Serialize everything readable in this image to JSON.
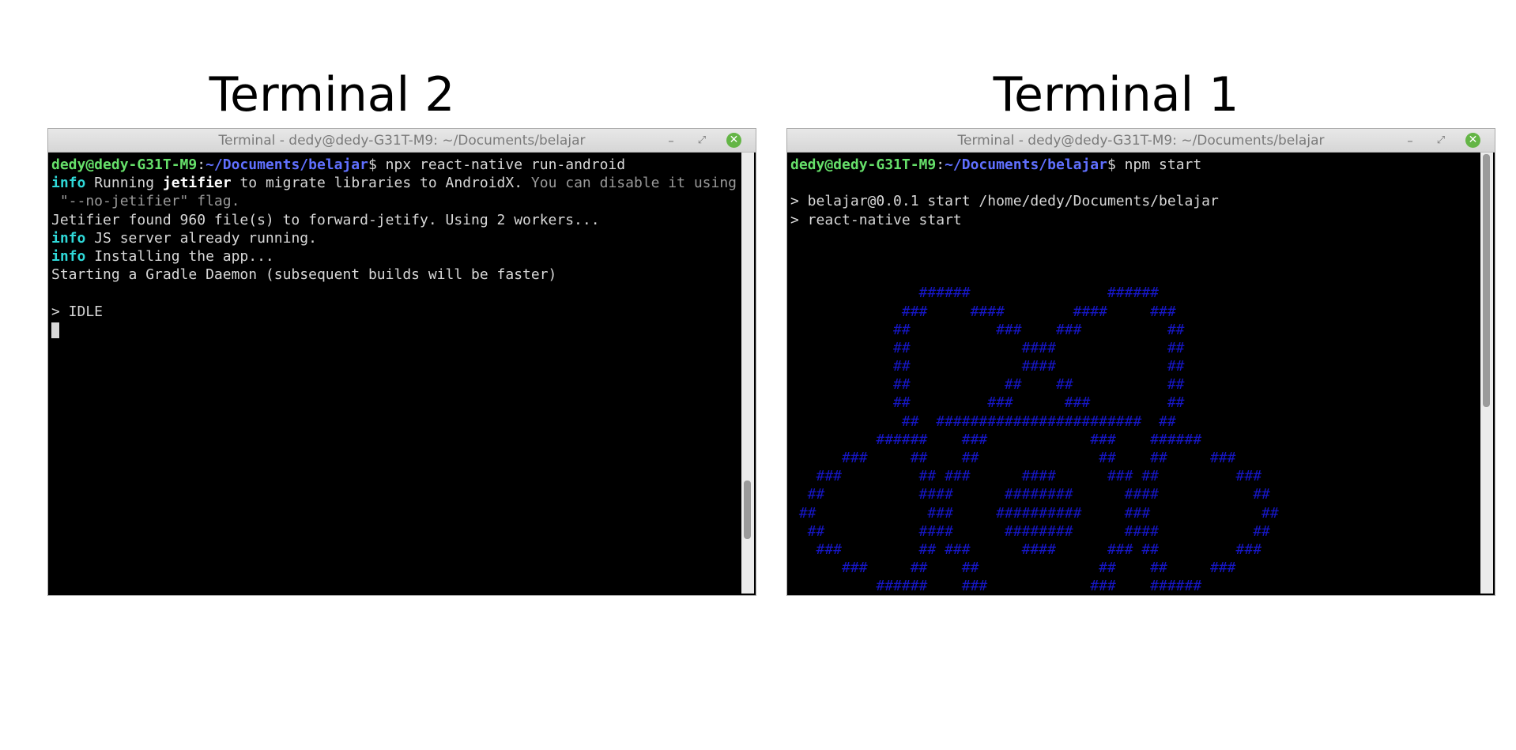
{
  "captions": {
    "left": "Terminal 2",
    "right": "Terminal 1"
  },
  "colors": {
    "prompt_user": "#66e06a",
    "prompt_path": "#6070ff",
    "info": "#2fd9d9",
    "ascii_logo": "#1616c6",
    "close_button": "#64b546"
  },
  "terminal2": {
    "title": "Terminal - dedy@dedy-G31T-M9: ~/Documents/belajar",
    "controls": {
      "minimize": "–",
      "maximize": "⤢",
      "close": "✕"
    },
    "prompt": {
      "user": "dedy@dedy-G31T-M9",
      "sep": ":",
      "path": "~/Documents/belajar",
      "sym": "$ ",
      "command": "npx react-native run-android"
    },
    "lines": {
      "l2": {
        "tag": "info",
        "a": " Running ",
        "bold": "jetifier",
        "b": " to migrate libraries to AndroidX.",
        "c": " You can disable it using"
      },
      "l3": " \"--no-jetifier\" flag.",
      "l4": "Jetifier found 960 file(s) to forward-jetify. Using 2 workers...",
      "l5": {
        "tag": "info",
        "text": " JS server already running."
      },
      "l6": {
        "tag": "info",
        "text": " Installing the app..."
      },
      "l7": "Starting a Gradle Daemon (subsequent builds will be faster)",
      "l9": "> IDLE"
    },
    "scroll_position": 0.86
  },
  "terminal1": {
    "title": "Terminal - dedy@dedy-G31T-M9: ~/Documents/belajar",
    "controls": {
      "minimize": "–",
      "maximize": "⤢",
      "close": "✕"
    },
    "prompt": {
      "user": "dedy@dedy-G31T-M9",
      "sep": ":",
      "path": "~/Documents/belajar",
      "sym": "$ ",
      "command": "npm start"
    },
    "output": [
      "> belajar@0.0.1 start /home/dedy/Documents/belajar",
      "> react-native start"
    ],
    "ascii_logo": [
      "               ######                ######",
      "             ###     ####        ####     ###",
      "            ##          ###    ###          ##",
      "            ##             ####             ##",
      "            ##             ####             ##",
      "            ##           ##    ##           ##",
      "            ##         ###      ###         ##",
      "             ##  ########################  ##",
      "          ######    ###            ###    ######",
      "      ###     ##    ##              ##    ##     ###",
      "   ###         ## ###      ####      ### ##         ###",
      "  ##           ####      ########      ####           ##",
      " ##             ###     ##########     ###             ##",
      "  ##           ####      ########      ####           ##",
      "   ###         ## ###      ####      ### ##         ###",
      "      ###     ##    ##              ##    ##     ###",
      "          ######    ###            ###    ######",
      "             ##  ########################  ##"
    ],
    "scroll_position": 0.0
  }
}
